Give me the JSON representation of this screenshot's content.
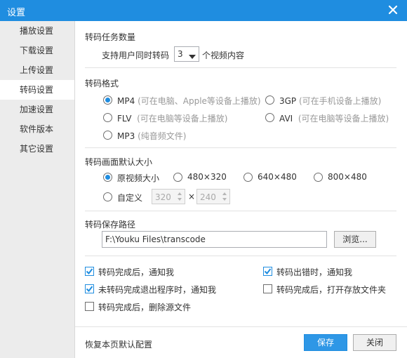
{
  "window": {
    "title": "设置"
  },
  "sidebar": {
    "items": [
      {
        "label": "播放设置"
      },
      {
        "label": "下载设置"
      },
      {
        "label": "上传设置"
      },
      {
        "label": "转码设置",
        "active": true
      },
      {
        "label": "加速设置"
      },
      {
        "label": "软件版本"
      },
      {
        "label": "其它设置"
      }
    ]
  },
  "task_count": {
    "title": "转码任务数量",
    "prefix": "支持用户同时转码",
    "value": "3",
    "suffix": "个视频内容"
  },
  "format": {
    "title": "转码格式",
    "options": [
      {
        "label": "MP4",
        "hint": "(可在电脑、Apple等设备上播放)",
        "selected": true
      },
      {
        "label": "3GP",
        "hint": "(可在手机设备上播放)",
        "selected": false
      },
      {
        "label": "FLV",
        "hint": "(可在电脑等设备上播放)",
        "selected": false
      },
      {
        "label": "AVI",
        "hint": "(可在电脑等设备上播放)",
        "selected": false
      },
      {
        "label": "MP3",
        "hint": "(纯音频文件)",
        "selected": false
      }
    ]
  },
  "size": {
    "title": "转码画面默认大小",
    "options": [
      {
        "label": "原视频大小",
        "selected": true
      },
      {
        "label": "480×320",
        "selected": false
      },
      {
        "label": "640×480",
        "selected": false
      },
      {
        "label": "800×480",
        "selected": false
      },
      {
        "label": "自定义",
        "selected": false
      }
    ],
    "custom_width": "320",
    "custom_height": "240",
    "times": "×"
  },
  "save_path": {
    "title": "转码保存路径",
    "value": "F:\\Youku Files\\transcode",
    "browse_label": "浏览..."
  },
  "notify": {
    "options": [
      {
        "label": "转码完成后，通知我",
        "checked": true
      },
      {
        "label": "转码出错时，通知我",
        "checked": true
      },
      {
        "label": "未转码完成退出程序时，通知我",
        "checked": true
      },
      {
        "label": "转码完成后，打开存放文件夹",
        "checked": false
      },
      {
        "label": "转码完成后，删除源文件",
        "checked": false
      }
    ]
  },
  "footer": {
    "restore_label": "恢复本页默认配置",
    "save_label": "保存",
    "close_label": "关闭"
  },
  "colors": {
    "accent": "#1f8de0",
    "sidebar_bg": "#ececec"
  }
}
